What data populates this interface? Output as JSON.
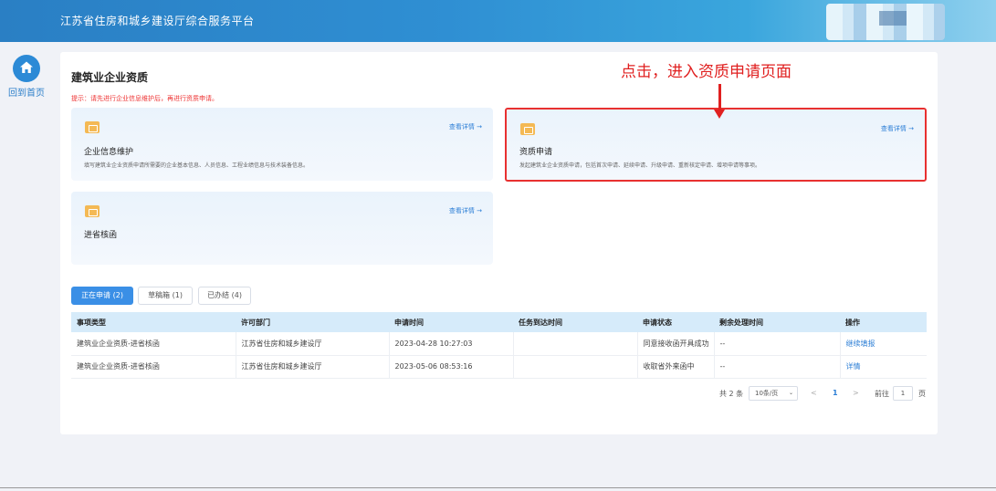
{
  "header": {
    "title": "江苏省住房和城乡建设厅综合服务平台"
  },
  "sidebar": {
    "home_label": "回到首页"
  },
  "page": {
    "title": "建筑业企业资质",
    "tip": "提示：请先进行企业信息维护后，再进行资质申请。"
  },
  "cards": [
    {
      "title": "企业信息维护",
      "more": "查看详情 →",
      "desc": "填写建筑业企业资质申请所需要的企业基本信息、人员信息、工程业绩信息与技术装备信息。"
    },
    {
      "title": "资质申请",
      "more": "查看详情 →",
      "desc": "发起建筑业企业资质申请，包括首次申请、延续申请、升级申请、重新核定申请、增项申请等事项。"
    },
    {
      "title": "进省核函",
      "more": "查看详情 →",
      "desc": ""
    }
  ],
  "annotation": {
    "text": "点击，进入资质申请页面",
    "color": "#e02020"
  },
  "tabs": [
    {
      "label": "正在申请 (2)",
      "active": true
    },
    {
      "label": "草稿箱 (1)",
      "active": false
    },
    {
      "label": "已办结 (4)",
      "active": false
    }
  ],
  "table": {
    "columns": [
      "事项类型",
      "许可部门",
      "申请时间",
      "任务到达时间",
      "申请状态",
      "剩余处理时间",
      "操作"
    ],
    "rows": [
      [
        "建筑业企业资质-进省核函",
        "江苏省住房和城乡建设厅",
        "2023-04-28 10:27:03",
        "",
        "同意接收函开具成功",
        "--",
        "继续填报"
      ],
      [
        "建筑业企业资质-进省核函",
        "江苏省住房和城乡建设厅",
        "2023-05-06 08:53:16",
        "",
        "收取省外来函中",
        "--",
        "详情"
      ]
    ]
  },
  "pagination": {
    "total": "共 2 条",
    "page_size": "10条/页",
    "prev": "<",
    "current": "1",
    "next": ">",
    "goto_label": "前往",
    "goto_value": "1",
    "page_unit": "页"
  },
  "colors": {
    "accent": "#3a8fe6",
    "highlight": "#e83030"
  }
}
